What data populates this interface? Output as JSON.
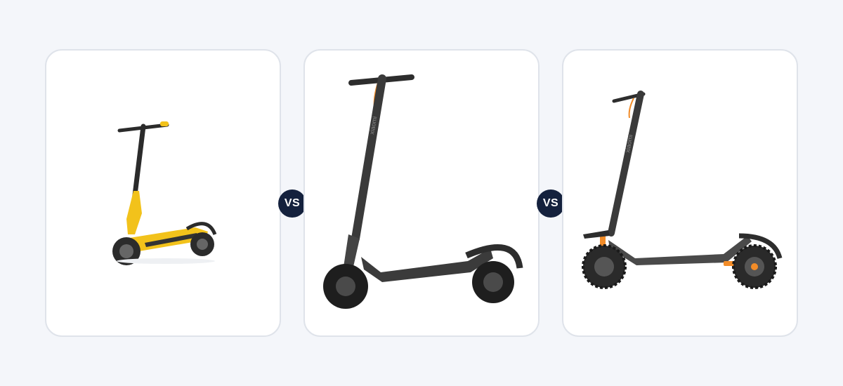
{
  "comparison": {
    "products": [
      {
        "image": "yellow-offroad-electric-scooter",
        "accent": "#f2c21b",
        "brand_mark": ""
      },
      {
        "image": "dark-gray-electric-scooter",
        "accent": "#f28c28",
        "brand_mark": "xiaomi"
      },
      {
        "image": "offroad-electric-scooter-orange-suspension",
        "accent": "#f28c28",
        "brand_mark": "xiaomi"
      }
    ],
    "separators": [
      {
        "label": "VS"
      },
      {
        "label": "VS"
      }
    ]
  },
  "colors": {
    "page_bg": "#f4f6fa",
    "card_bg": "#ffffff",
    "card_border": "#dfe3ea",
    "badge_bg": "#14213d",
    "badge_text": "#ffffff"
  }
}
